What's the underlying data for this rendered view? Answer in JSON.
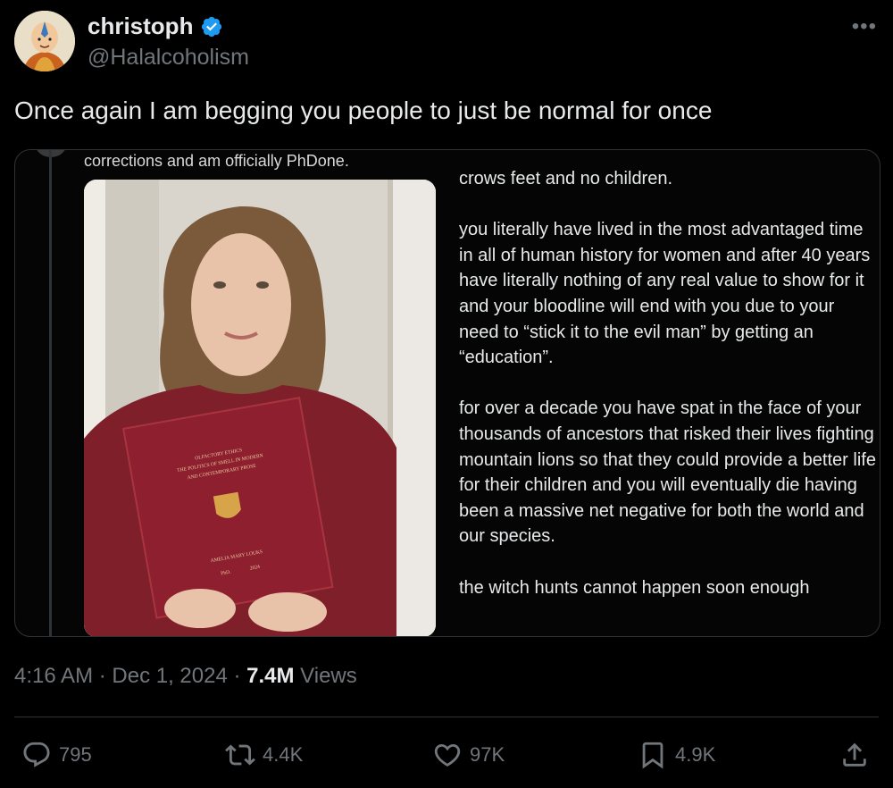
{
  "author": {
    "display_name": "christoph",
    "handle": "@Halalcoholism",
    "verified": true,
    "verified_color": "#1d9bf0",
    "avatar_icon": "avatar-aang-icon"
  },
  "more_icon": "more-horizontal-icon",
  "tweet": {
    "text": "Once again I am begging you people to just be normal for once"
  },
  "embedded": {
    "top_text": "corrections and am officially PhDone.",
    "paragraphs": [
      "crows feet and no children.",
      "you literally have lived in the most advantaged time in all of human history for women and after 40 years have literally nothing of any real value to show for it and your bloodline will end with you due to your need to “stick it to the evil man” by getting an “education”.",
      "for over a decade you have spat in the face of your thousands of ancestors that risked their lives fighting mountain lions so that they could provide a better life for their children and you will eventually die having been a massive net negative for both the world and our species.",
      "the witch hunts cannot happen soon enough"
    ],
    "book": {
      "title_line1": "OLFACTORY ETHICS",
      "title_line2": "THE POLITICS OF SMELL IN MODERN",
      "title_line3": "AND CONTEMPORARY PROSE",
      "author": "AMELIA MARY LOUKS",
      "degree": "PhD.",
      "year": "2024",
      "cover_color": "#8e1f2e"
    }
  },
  "meta": {
    "time": "4:16 AM",
    "separator": " · ",
    "date": "Dec 1, 2024",
    "views_count": "7.4M",
    "views_label": " Views"
  },
  "actions": {
    "reply": {
      "icon": "reply-icon",
      "count": "795"
    },
    "retweet": {
      "icon": "retweet-icon",
      "count": "4.4K"
    },
    "like": {
      "icon": "heart-icon",
      "count": "97K"
    },
    "bookmark": {
      "icon": "bookmark-icon",
      "count": "4.9K"
    },
    "share": {
      "icon": "share-icon"
    }
  },
  "colors": {
    "background": "#000000",
    "text_primary": "#e7e9ea",
    "text_secondary": "#71767b",
    "border": "#2f3336"
  }
}
